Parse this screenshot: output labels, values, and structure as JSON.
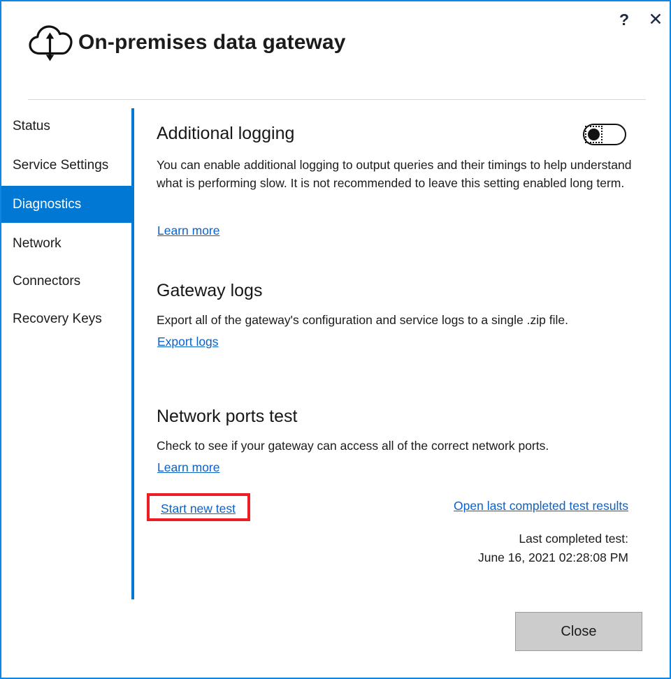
{
  "window": {
    "title": "On-premises data gateway",
    "logo_icon": "cloud-updown-arrow-icon",
    "help_label": "?",
    "close_label": "✕"
  },
  "sidebar": {
    "items": [
      {
        "label": "Status",
        "selected": false
      },
      {
        "label": "Service Settings",
        "selected": false
      },
      {
        "label": "Diagnostics",
        "selected": true
      },
      {
        "label": "Network",
        "selected": false
      },
      {
        "label": "Connectors",
        "selected": false
      },
      {
        "label": "Recovery Keys",
        "selected": false
      }
    ]
  },
  "main": {
    "additional_logging": {
      "heading": "Additional logging",
      "description": "You can enable additional logging to output queries and their timings to help understand what is performing slow. It is not recommended to leave this setting enabled long term.",
      "link_label": "Learn more",
      "toggle_state": "off"
    },
    "gateway_logs": {
      "heading": "Gateway logs",
      "description": "Export all of the gateway's configuration and service logs to a single .zip file.",
      "link_label": "Export logs"
    },
    "network_ports_test": {
      "heading": "Network ports test",
      "description": "Check to see if your gateway can access all of the correct network ports.",
      "link_label": "Learn more",
      "start_test_label": "Start new test",
      "open_results_label": "Open last completed test results",
      "last_test_caption": "Last completed test:",
      "last_test_timestamp": "June 16, 2021 02:28:08 PM"
    }
  },
  "footer": {
    "close_label": "Close"
  },
  "colors": {
    "accent": "#0078d4",
    "window_border": "#0c87e8",
    "link": "#0a62c9",
    "annotation": "#ee1d24",
    "button_face": "#cccccc"
  }
}
